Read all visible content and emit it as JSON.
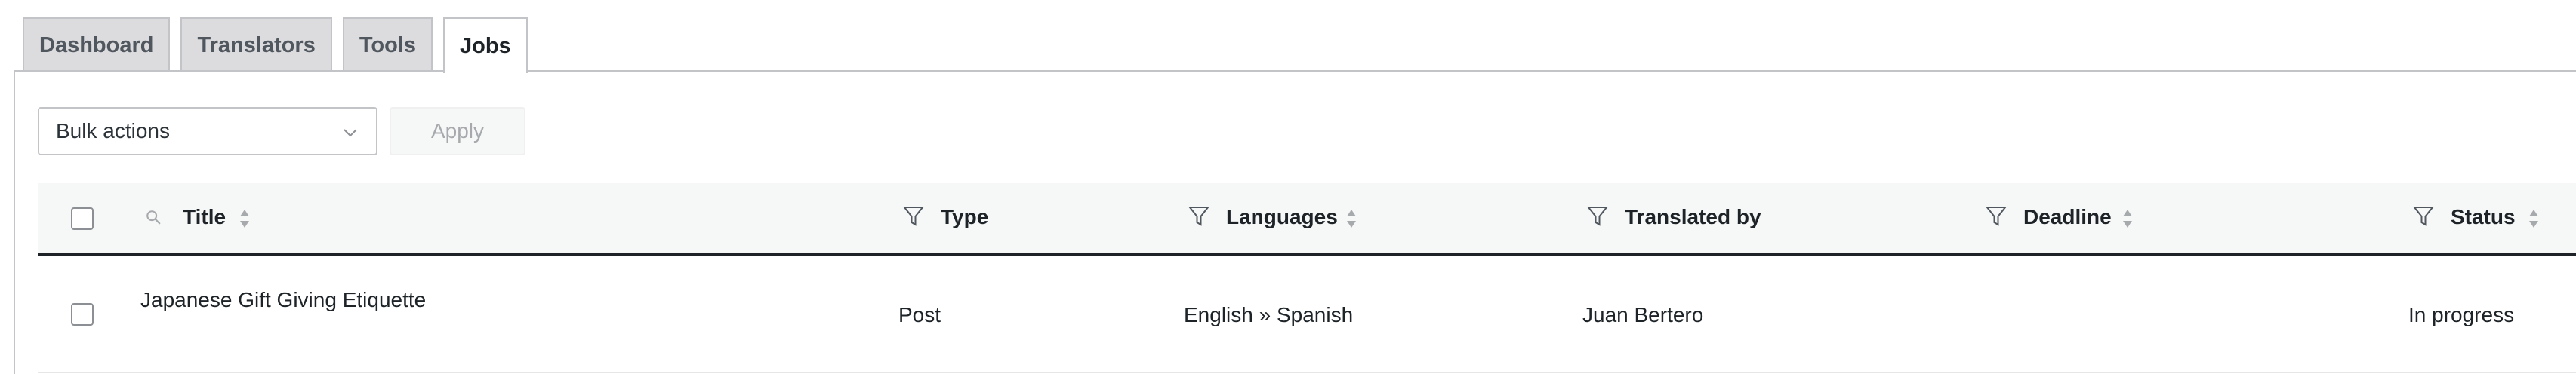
{
  "tabs": [
    {
      "label": "Dashboard"
    },
    {
      "label": "Translators"
    },
    {
      "label": "Tools"
    },
    {
      "label": "Jobs",
      "active": true
    }
  ],
  "bulk_actions": {
    "selected": "Bulk actions",
    "apply_label": "Apply"
  },
  "table": {
    "columns": [
      {
        "label": "Title",
        "icons": [
          "search-icon",
          "sort-icon"
        ]
      },
      {
        "label": "Type",
        "icons": [
          "filter-icon"
        ]
      },
      {
        "label": "Languages",
        "icons": [
          "filter-icon",
          "sort-icon"
        ]
      },
      {
        "label": "Translated by",
        "icons": [
          "filter-icon"
        ]
      },
      {
        "label": "Deadline",
        "icons": [
          "filter-icon",
          "sort-icon"
        ]
      },
      {
        "label": "Status",
        "icons": [
          "filter-icon",
          "sort-icon"
        ]
      }
    ],
    "rows": [
      {
        "title": "Japanese Gift Giving Etiquette",
        "type": "Post",
        "languages": "English » Spanish",
        "translated_by": "Juan Bertero",
        "deadline": "",
        "status": "In progress"
      }
    ]
  },
  "colors": {
    "tab_inactive_bg": "#dcdcde",
    "header_bg": "#f6f7f7",
    "header_border": "#1d2327",
    "muted_icon": "#8c8f94"
  }
}
